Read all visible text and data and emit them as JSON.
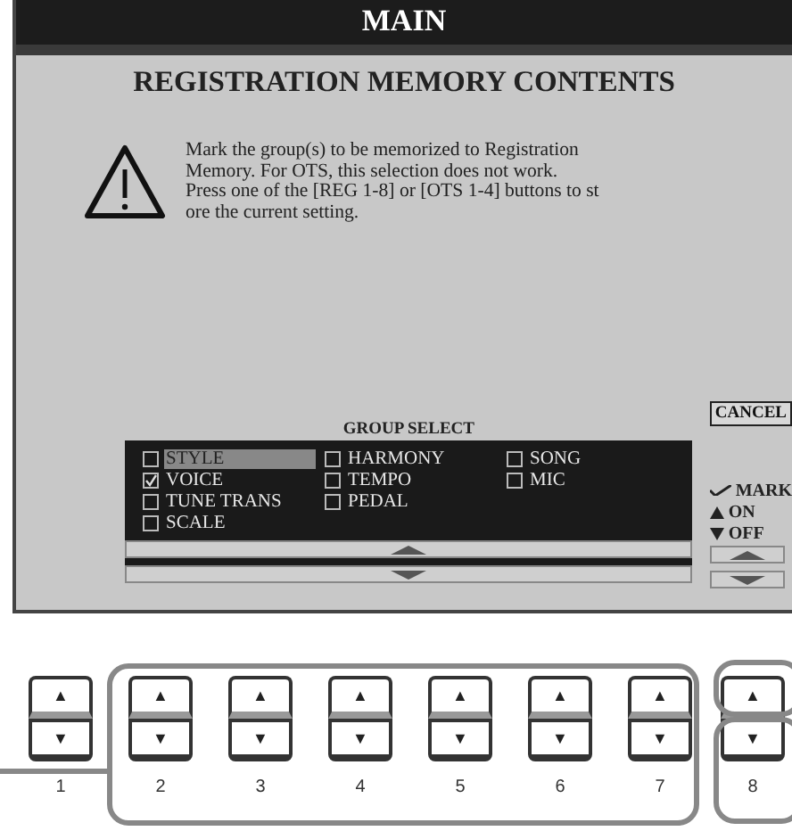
{
  "screen": {
    "title": "MAIN",
    "dialog": {
      "title": "REGISTRATION MEMORY CONTENTS",
      "message": "Mark the group(s) to be memorized to Registration\nMemory. For OTS, this selection does not work.\nPress one of the [REG 1-8] or [OTS 1-4] buttons to st\nore the current setting.",
      "cancel": "CANCEL",
      "group_select": {
        "title": "GROUP SELECT",
        "columns": [
          [
            {
              "label": "STYLE",
              "checked": false,
              "selected": true
            },
            {
              "label": "VOICE",
              "checked": true,
              "selected": false
            },
            {
              "label": "TUNE TRANS",
              "checked": false,
              "selected": false
            },
            {
              "label": "SCALE",
              "checked": false,
              "selected": false
            }
          ],
          [
            {
              "label": "HARMONY",
              "checked": false,
              "selected": false
            },
            {
              "label": "TEMPO",
              "checked": false,
              "selected": false
            },
            {
              "label": "PEDAL",
              "checked": false,
              "selected": false
            }
          ],
          [
            {
              "label": "SONG",
              "checked": false,
              "selected": false
            },
            {
              "label": "MIC",
              "checked": false,
              "selected": false
            }
          ]
        ]
      },
      "legend": [
        {
          "kind": "check",
          "label": "MARK"
        },
        {
          "kind": "up",
          "label": "ON"
        },
        {
          "kind": "down",
          "label": "OFF"
        }
      ]
    }
  },
  "buttons": [
    {
      "label": "1",
      "up": "▲",
      "down": "▼"
    },
    {
      "label": "2",
      "up": "▲",
      "down": "▼"
    },
    {
      "label": "3",
      "up": "▲",
      "down": "▼"
    },
    {
      "label": "4",
      "up": "▲",
      "down": "▼"
    },
    {
      "label": "5",
      "up": "▲",
      "down": "▼"
    },
    {
      "label": "6",
      "up": "▲",
      "down": "▼"
    },
    {
      "label": "7",
      "up": "▲",
      "down": "▼"
    },
    {
      "label": "8",
      "up": "▲",
      "down": "▼"
    }
  ]
}
